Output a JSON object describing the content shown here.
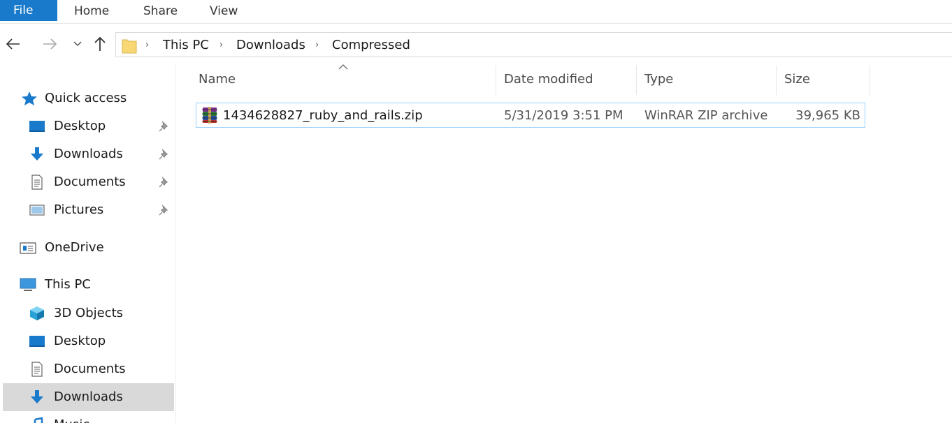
{
  "ribbon": {
    "tabs": [
      "File",
      "Home",
      "Share",
      "View"
    ]
  },
  "nav": {
    "back_icon": "back-arrow-icon",
    "forward_icon": "forward-arrow-icon",
    "recent_icon": "chevron-down-icon",
    "up_icon": "up-arrow-icon",
    "breadcrumb": [
      "This PC",
      "Downloads",
      "Compressed"
    ]
  },
  "sidebar": {
    "items": [
      {
        "label": "Quick access",
        "icon": "star-icon"
      },
      {
        "label": "Desktop",
        "icon": "desktop-icon",
        "pinned": true
      },
      {
        "label": "Downloads",
        "icon": "download-icon",
        "pinned": true
      },
      {
        "label": "Documents",
        "icon": "document-icon",
        "pinned": true
      },
      {
        "label": "Pictures",
        "icon": "pictures-icon",
        "pinned": true
      },
      {
        "label": "OneDrive",
        "icon": "onedrive-icon"
      },
      {
        "label": "This PC",
        "icon": "computer-icon"
      },
      {
        "label": "3D Objects",
        "icon": "cube-icon"
      },
      {
        "label": "Desktop",
        "icon": "desktop-icon"
      },
      {
        "label": "Documents",
        "icon": "document-icon"
      },
      {
        "label": "Downloads",
        "icon": "download-icon",
        "selected": true
      },
      {
        "label": "Music",
        "icon": "music-icon"
      }
    ]
  },
  "filelist": {
    "columns": {
      "name": "Name",
      "date": "Date modified",
      "type": "Type",
      "size": "Size"
    },
    "sorted_by": "Name",
    "rows": [
      {
        "name": "1434628827_ruby_and_rails.zip",
        "date": "5/31/2019 3:51 PM",
        "type": "WinRAR ZIP archive",
        "size": "39,965 KB",
        "icon": "winrar-archive-icon"
      }
    ]
  },
  "colors": {
    "accent": "#1979ca",
    "selection_border": "#99d1ff",
    "selected_bg": "#d9d9d9"
  }
}
